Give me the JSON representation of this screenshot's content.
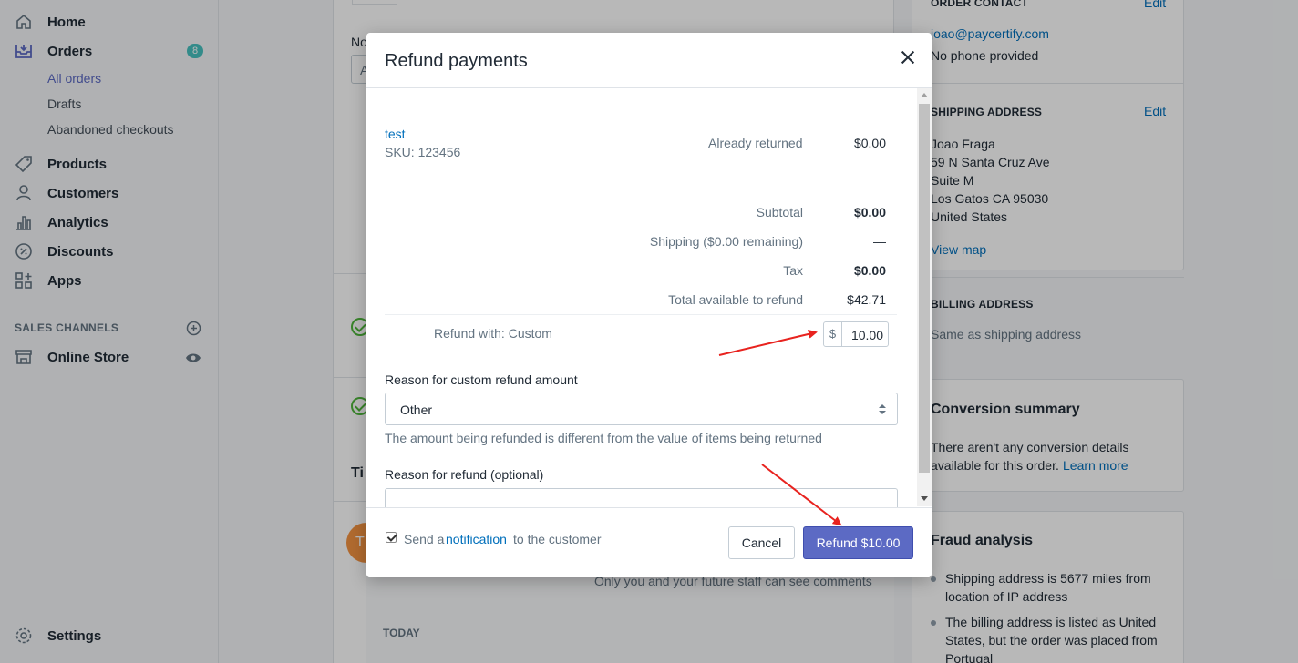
{
  "sidebar": {
    "home": "Home",
    "orders": "Orders",
    "orders_badge": "8",
    "all_orders": "All orders",
    "drafts": "Drafts",
    "abandoned": "Abandoned checkouts",
    "products": "Products",
    "customers": "Customers",
    "analytics": "Analytics",
    "discounts": "Discounts",
    "apps": "Apps",
    "sales_channels": "SALES CHANNELS",
    "online_store": "Online Store",
    "settings": "Settings"
  },
  "background": {
    "no_label": "No",
    "a_label": "A",
    "ti_label": "Ti",
    "avatar_initial": "T",
    "comment_hint": "Only you and your future staff can see comments",
    "today": "TODAY"
  },
  "right": {
    "order_contact_title": "ORDER CONTACT",
    "edit": "Edit",
    "email": "joao@paycertify.com",
    "phone": "No phone provided",
    "shipping_title": "SHIPPING ADDRESS",
    "ship_lines": [
      "Joao Fraga",
      "59 N Santa Cruz Ave",
      "Suite M",
      "Los Gatos CA 95030",
      "United States"
    ],
    "view_map": "View map",
    "billing_title": "BILLING ADDRESS",
    "billing_same": "Same as shipping address",
    "conversion_title": "Conversion summary",
    "conversion_line1": "There aren't any conversion details",
    "conversion_line2": "available for this order.",
    "learn_more": "Learn more",
    "fraud_title": "Fraud analysis",
    "fraud_1a": "Shipping address is 5677 miles from",
    "fraud_1b": "location of IP address",
    "fraud_2a": "The billing address is listed as United",
    "fraud_2b": "States, but the order was placed from",
    "fraud_2c": "Portugal"
  },
  "modal": {
    "title": "Refund payments",
    "item_name": "test",
    "item_sku": "SKU: 123456",
    "already_returned_label": "Already returned",
    "already_returned_value": "$0.00",
    "subtotal_label": "Subtotal",
    "subtotal_value": "$0.00",
    "shipping_label": "Shipping ($0.00 remaining)",
    "shipping_value": "—",
    "tax_label": "Tax",
    "tax_value": "$0.00",
    "total_available_label": "Total available to refund",
    "total_available_value": "$42.71",
    "refund_with_label": "Refund with: Custom",
    "currency_prefix": "$",
    "refund_amount": "10.00",
    "reason_custom_label": "Reason for custom refund amount",
    "reason_selected": "Other",
    "reason_help": "The amount being refunded is different from the value of items being returned",
    "reason_optional_label": "Reason for refund (optional)",
    "notify_prefix": "Send a",
    "notify_link": "notification",
    "notify_suffix": "to the customer",
    "notify_checked": true,
    "cancel_label": "Cancel",
    "refund_label": "Refund $10.00"
  },
  "colors": {
    "accent": "#5c6ac4",
    "link": "#006fbb",
    "badge": "#47c1bf",
    "annotation_arrow": "#e8231f"
  }
}
